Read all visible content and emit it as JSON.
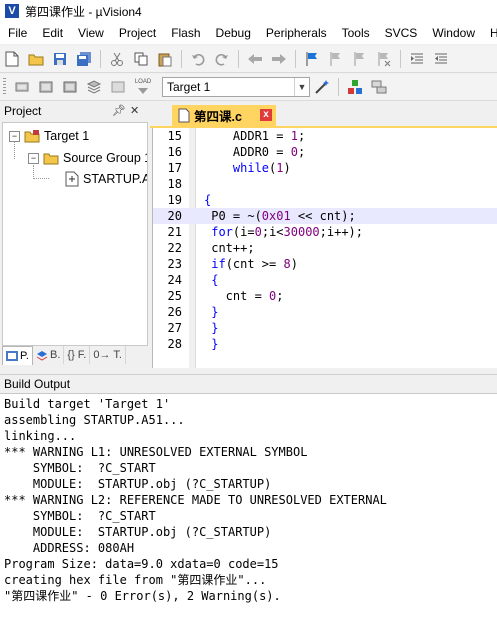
{
  "title_bar": {
    "title": "第四课作业 - µVision4"
  },
  "menu": [
    "File",
    "Edit",
    "View",
    "Project",
    "Flash",
    "Debug",
    "Peripherals",
    "Tools",
    "SVCS",
    "Window",
    "Help"
  ],
  "toolbar2": {
    "load_label": "LOAD",
    "target": "Target 1"
  },
  "project_panel": {
    "title": "Project",
    "tree": [
      {
        "label": "Target 1",
        "expander": "−"
      },
      {
        "label": "Source Group 1",
        "expander": "−"
      },
      {
        "label": "STARTUP.A51",
        "expander": ""
      }
    ],
    "tabs": [
      "P.",
      "B.",
      "{} F.",
      "0→ T."
    ]
  },
  "editor": {
    "tab_label": "第四课.c",
    "close_glyph": "x",
    "highlight_line": 20,
    "lines": [
      {
        "n": "15",
        "text": "    ADDR1 = 1;"
      },
      {
        "n": "16",
        "text": "    ADDR0 = 0;"
      },
      {
        "n": "17",
        "text": "    while(1)"
      },
      {
        "n": "18",
        "text": ""
      },
      {
        "n": "19",
        "text": "{"
      },
      {
        "n": "20",
        "text": " P0 = ~(0x01 << cnt);"
      },
      {
        "n": "21",
        "text": " for(i=0;i<30000;i++);"
      },
      {
        "n": "22",
        "text": " cnt++;"
      },
      {
        "n": "23",
        "text": " if(cnt >= 8)"
      },
      {
        "n": "24",
        "text": " {"
      },
      {
        "n": "25",
        "text": "   cnt = 0;"
      },
      {
        "n": "26",
        "text": " }"
      },
      {
        "n": "27",
        "text": " }"
      },
      {
        "n": "28",
        "text": " }"
      }
    ]
  },
  "build_output": {
    "title": "Build Output",
    "lines": [
      "Build target 'Target 1'",
      "assembling STARTUP.A51...",
      "linking...",
      "*** WARNING L1: UNRESOLVED EXTERNAL SYMBOL",
      "    SYMBOL:  ?C_START",
      "    MODULE:  STARTUP.obj (?C_STARTUP)",
      "*** WARNING L2: REFERENCE MADE TO UNRESOLVED EXTERNAL",
      "    SYMBOL:  ?C_START",
      "    MODULE:  STARTUP.obj (?C_STARTUP)",
      "    ADDRESS: 080AH",
      "Program Size: data=9.0 xdata=0 code=15",
      "creating hex file from \"第四课作业\"...",
      "\"第四课作业\" - 0 Error(s), 2 Warning(s)."
    ]
  },
  "colors": {
    "tab_accent": "#ffd461",
    "keyword": "#0000ff",
    "number": "#800080",
    "highlight": "#e8e8ff"
  }
}
